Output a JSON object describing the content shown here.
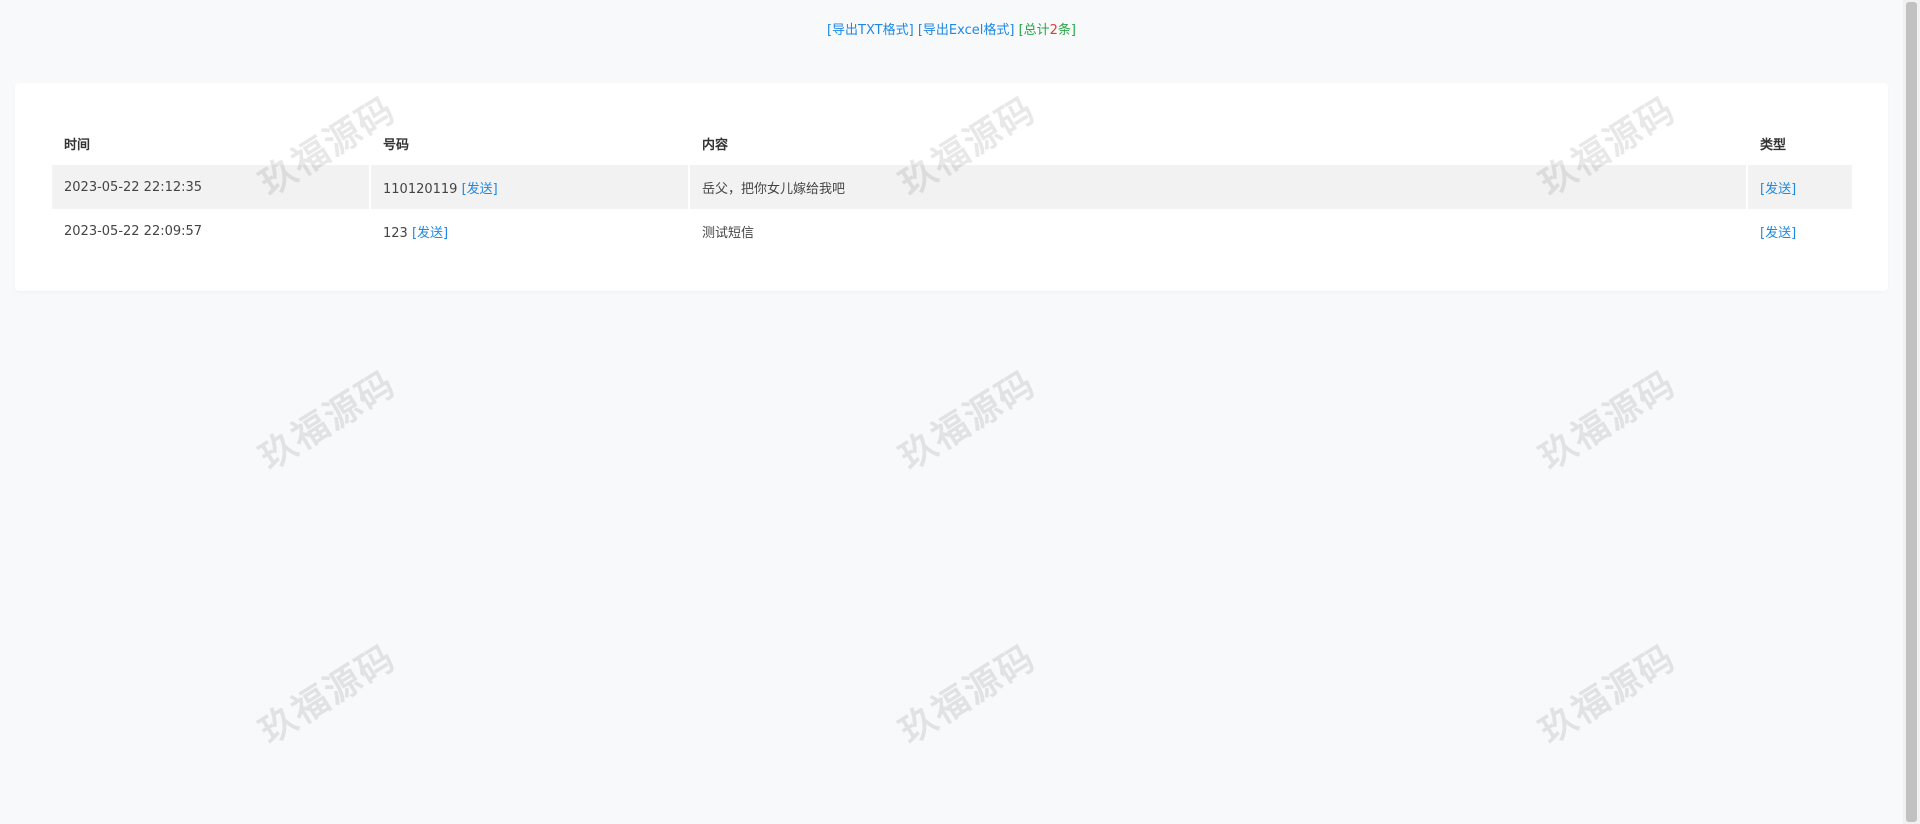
{
  "toolbar": {
    "export_txt": "[导出TXT格式]",
    "export_excel": "[导出Excel格式]",
    "total_prefix": "[总计",
    "total_count": "2",
    "total_suffix": "条]"
  },
  "table": {
    "headers": [
      "时间",
      "号码",
      "内容",
      "类型"
    ],
    "rows": [
      {
        "time": "2023-05-22 22:12:35",
        "number": "110120119",
        "send_link": "[发送]",
        "content": "岳父，把你女儿嫁给我吧",
        "type": "[发送]"
      },
      {
        "time": "2023-05-22 22:09:57",
        "number": "123",
        "send_link": "[发送]",
        "content": "测试短信",
        "type": "[发送]"
      }
    ]
  },
  "watermark": {
    "text": "玖福源码"
  }
}
